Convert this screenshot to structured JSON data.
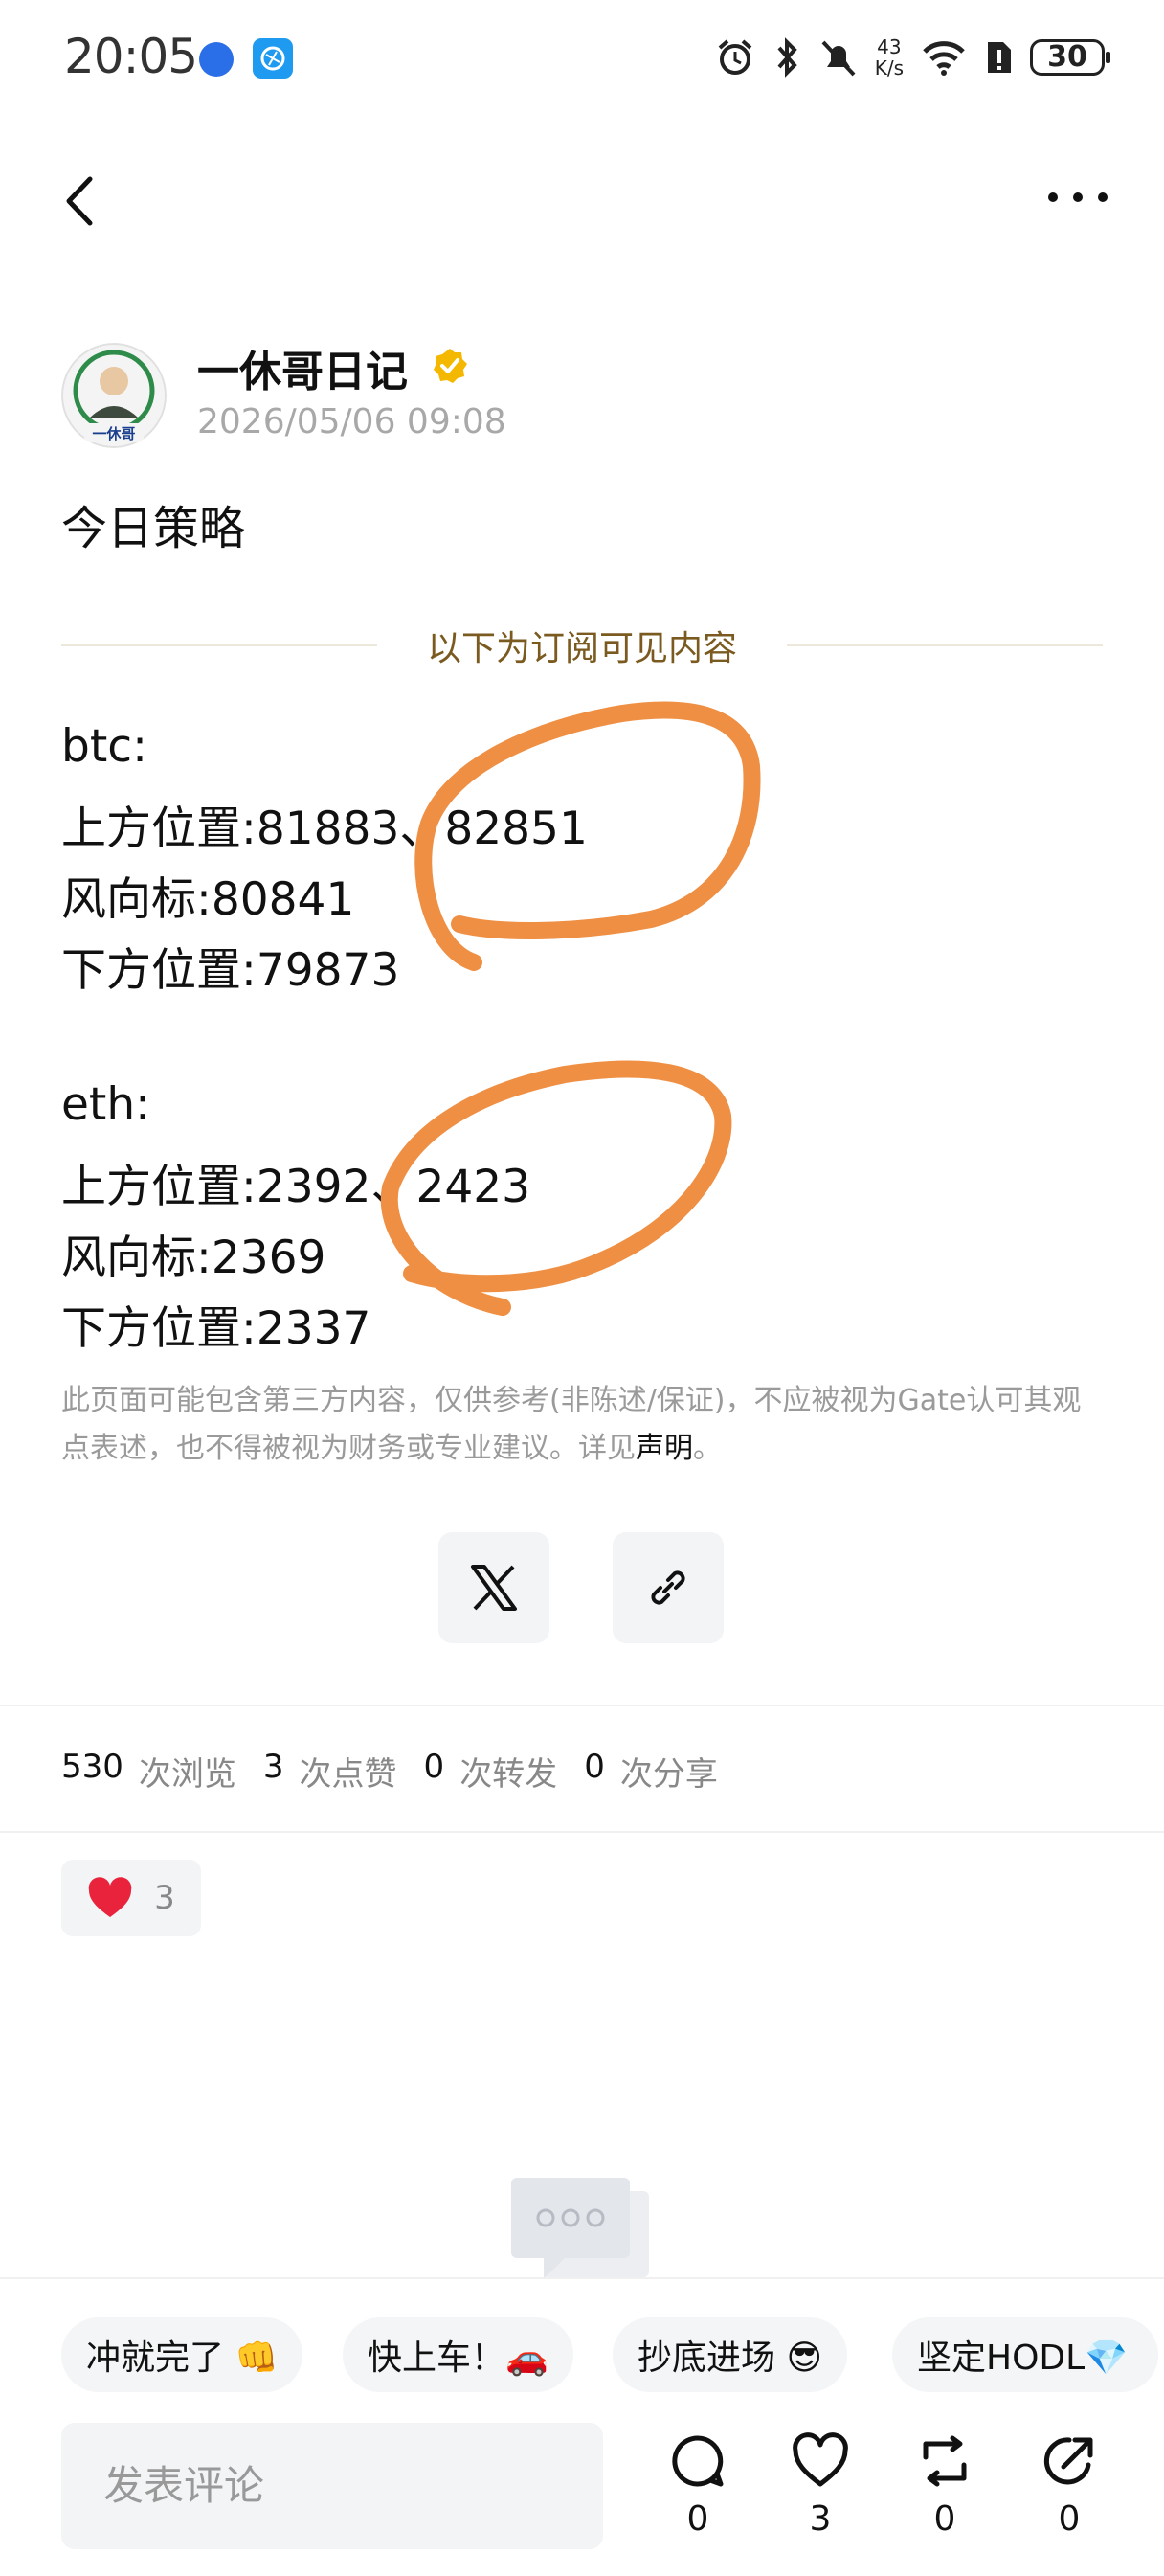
{
  "status_bar": {
    "time": "20:05",
    "net_speed_top": "43",
    "net_speed_bottom": "K/s",
    "battery": "30"
  },
  "author": {
    "name": "一休哥日记",
    "date": "2026/05/06 09:08",
    "avatar_label": "一休哥"
  },
  "post": {
    "title": "今日策略",
    "divider_text": "以下为订阅可见内容",
    "lines": [
      "btc:",
      "上方位置:81883、82851",
      "风向标:80841",
      "下方位置:79873",
      "eth:",
      "上方位置:2392、2423",
      "风向标:2369",
      "下方位置:2337"
    ],
    "disclaimer": "此页面可能包含第三方内容，仅供参考(非陈述/保证)，不应被视为Gate认可其观点表述，也不得被视为财务或专业建议。详见",
    "disclaimer_link": "声明",
    "disclaimer_end": "。"
  },
  "share": {
    "icons": [
      "x-icon",
      "link-icon"
    ]
  },
  "stats": [
    {
      "num": "530",
      "label": "次浏览"
    },
    {
      "num": "3",
      "label": "次点赞"
    },
    {
      "num": "0",
      "label": "次转发"
    },
    {
      "num": "0",
      "label": "次分享"
    }
  ],
  "reaction": {
    "icon": "heart-icon",
    "count": "3"
  },
  "quick_replies": [
    "冲就完了 👊",
    "快上车！🚗",
    "抄底进场 😎",
    "坚定HODL💎"
  ],
  "comment_input": {
    "placeholder": "发表评论"
  },
  "actions": [
    {
      "icon": "comment-icon",
      "count": "0"
    },
    {
      "icon": "heart-outline-icon",
      "count": "3"
    },
    {
      "icon": "repost-icon",
      "count": "0"
    },
    {
      "icon": "share-icon",
      "count": "0"
    }
  ],
  "colors": {
    "annotation": "#ef8f43",
    "divider_text": "#7a5a1f",
    "verified": "#f5b800"
  }
}
